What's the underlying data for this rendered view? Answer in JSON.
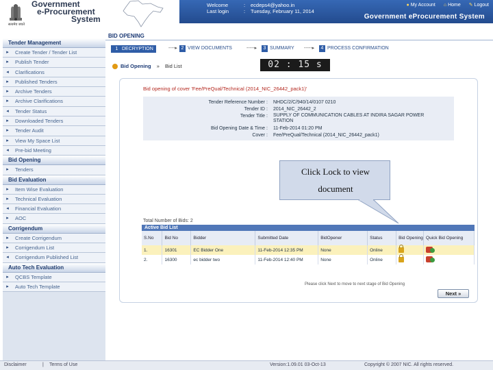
{
  "header": {
    "logo_line1": "Government",
    "logo_line2": "e-Procurement",
    "logo_line3": "System",
    "emblem_caption": "सत्यमेव जयते",
    "welcome_label": "Welcome",
    "welcome_value": "ecdeps4@yahoo.in",
    "lastlogin_label": "Last login",
    "lastlogin_value": "Tuesday, February 11, 2014",
    "colon": ":",
    "links": [
      "My Account",
      "Home",
      "Logout"
    ],
    "system_title": "Government eProcurement System"
  },
  "sidebar": {
    "sections": [
      {
        "title": "Tender Management",
        "items": [
          "Create Tender / Tender List",
          "Publish Tender",
          "Clarifications",
          "Published Tenders",
          "Archive Tenders",
          "Archive Clarifications",
          "Tender Status",
          "Downloaded Tenders",
          "Tender Audit",
          "View My Space List",
          "Pre-bid Meeting"
        ]
      },
      {
        "title": "Bid Opening",
        "items": [
          "Tenders"
        ]
      },
      {
        "title": "Bid Evaluation",
        "items": [
          "Item Wise Evaluation",
          "Technical Evaluation",
          "Financial Evaluation",
          "AOC"
        ]
      },
      {
        "title": "Corrigendum",
        "items": [
          "Create Corrigendum",
          "Corrigendum List",
          "Corrigendum Published List"
        ]
      },
      {
        "title": "Auto Tech Evaluation",
        "items": [
          "QCBS Template",
          "Auto Tech Template"
        ]
      }
    ]
  },
  "main": {
    "page_title": "BID OPENING",
    "steps": [
      {
        "num": "1",
        "label": "DECRYPTION"
      },
      {
        "num": "2",
        "label": "VIEW DOCUMENTS"
      },
      {
        "num": "3",
        "label": "SUMMARY"
      },
      {
        "num": "4",
        "label": "PROCESS CONFIRMATION"
      }
    ],
    "breadcrumb_home": "Bid Opening",
    "breadcrumb_sep": "»",
    "breadcrumb_current": "Bid List",
    "timer": "02 : 15 s",
    "cover_title": "Bid opening of cover 'Fee/PreQual/Technical (2014_NIC_26442_pack1)'",
    "cover_fields": [
      {
        "label": "Tender Reference Number",
        "value": "NHDC/2/C/940/14/0107 0210"
      },
      {
        "label": "Tender ID",
        "value": "2014_NIC_26442_2"
      },
      {
        "label": "Tender Title",
        "value": "SUPPLY OF COMMUNICATION CABLES AT INDIRA SAGAR POWER STATION"
      },
      {
        "label": "Bid Opening Date & Time",
        "value": "11-Feb-2014 01:20 PM"
      },
      {
        "label": "Cover",
        "value": "Fee/PreQual/Technical (2014_NIC_26442_pack1)"
      }
    ],
    "total_bids": "Total Number of Bids: 2",
    "bid_list_title": "Active Bid List",
    "columns": [
      "S.No",
      "Bid No",
      "Bidder",
      "Submitted Date",
      "BidOpener",
      "Status",
      "Bid Opening",
      "Quick Bid Opening"
    ],
    "rows": [
      {
        "sno": "1.",
        "bidno": "16301",
        "bidder": "EC Bidder One",
        "date": "11-Feb-2014 12:35 PM",
        "opener": "None",
        "status": "Online"
      },
      {
        "sno": "2.",
        "bidno": "16300",
        "bidder": "ec bidder two",
        "date": "11-Feb-2014 12:40 PM",
        "opener": "None",
        "status": "Online"
      }
    ],
    "note": "Please click Next to move to next stage of Bid Opening",
    "next_label": "Next »"
  },
  "callout": {
    "line1": "Click Lock to view",
    "line2": "document"
  },
  "footer": {
    "disclaimer": "Disclaimer",
    "divider": "|",
    "terms": "Terms of Use",
    "version": "Version:1.09.01 03-Oct-13",
    "copyright": "Copyright © 2007 NIC. All rights reserved."
  },
  "colors": {
    "header_blue": "#2b55a0",
    "sidebar_bg": "#dde4ef",
    "highlight_row": "#fbf1bc",
    "cover_title": "#b3271e"
  }
}
